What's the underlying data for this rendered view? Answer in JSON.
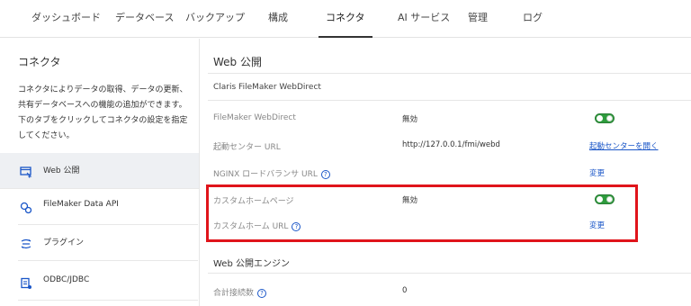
{
  "topnav": {
    "tabs": [
      {
        "label": "ダッシュボード"
      },
      {
        "label": "データベース"
      },
      {
        "label": "バックアップ"
      },
      {
        "label": "構成"
      },
      {
        "label": "コネクタ"
      },
      {
        "label": "AI サービス"
      },
      {
        "label": "管理"
      },
      {
        "label": "ログ"
      }
    ],
    "active": "コネクタ"
  },
  "sidebar": {
    "title": "コネクタ",
    "description": "コネクタによりデータの取得、データの更新、共有データベースへの機能の追加ができます。下のタブをクリックしてコネクタの設定を指定してください。",
    "items": [
      {
        "label": "Web 公開",
        "icon": "web-publish-icon"
      },
      {
        "label": "FileMaker Data API",
        "icon": "data-api-icon"
      },
      {
        "label": "プラグイン",
        "icon": "plugin-icon"
      },
      {
        "label": "ODBC/JDBC",
        "icon": "odbc-icon"
      }
    ]
  },
  "main": {
    "title": "Web 公開",
    "section1": {
      "title": "Claris FileMaker WebDirect",
      "rows": [
        {
          "label": "FileMaker WebDirect",
          "value": "無効",
          "control": "toggle"
        },
        {
          "label": "起動センター URL",
          "value": "http://127.0.0.1/fmi/webd",
          "action": "起動センターを開く"
        },
        {
          "label": "NGINX ロードバランサ URL",
          "value": "",
          "action": "変更"
        },
        {
          "label": "カスタムホームページ",
          "value": "無効",
          "control": "toggle"
        },
        {
          "label": "カスタムホーム URL",
          "value": "",
          "action": "変更"
        }
      ]
    },
    "section2": {
      "title": "Web 公開エンジン",
      "rows": [
        {
          "label": "合計接続数",
          "value": "0"
        }
      ]
    }
  },
  "colors": {
    "accent_link": "#1a56c8",
    "toggle_on": "#2e9b3d",
    "highlight_border": "#e0141b"
  }
}
